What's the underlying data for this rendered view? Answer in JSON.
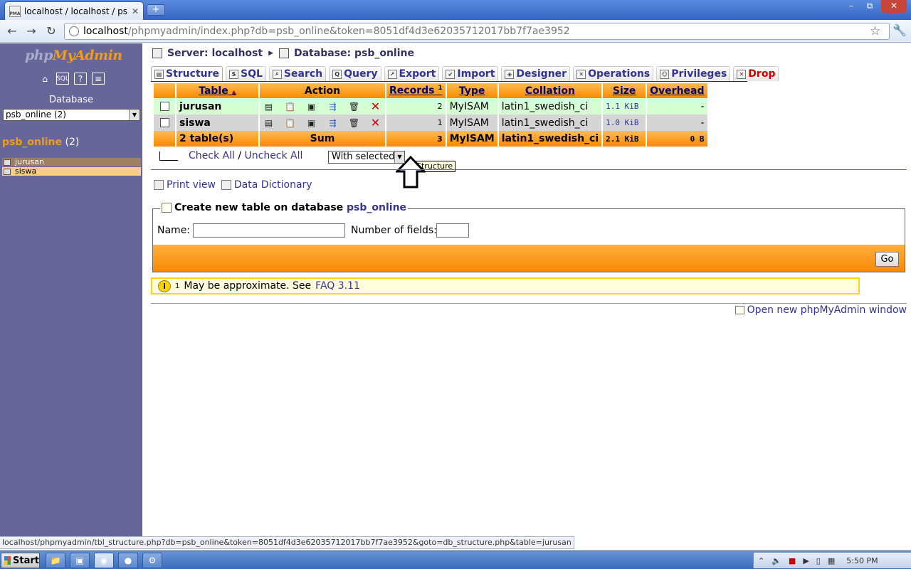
{
  "browser": {
    "tab_title": "localhost / localhost / psb_onli",
    "tab_favicon_text": "PMA",
    "url_host": "localhost",
    "url_rest": "/phpmyadmin/index.php?db=psb_online&token=8051df4d3e62035712017bb7f7ae3952",
    "new_tab_label": "+",
    "minimize_label": "–",
    "maximize_label": "⧉",
    "close_label": "✕"
  },
  "left": {
    "logo_php": "php",
    "logo_myadmin": "MyAdmin",
    "database_label": "Database",
    "database_select": "psb_online (2)",
    "current_db_name": "psb_online",
    "current_db_count": "(2)",
    "tables": [
      "jurusan",
      "siswa"
    ]
  },
  "breadcrumb": {
    "server": "Server: localhost",
    "database": "Database: psb_online"
  },
  "tabs": [
    {
      "label": "Structure",
      "icon": "structure-icon"
    },
    {
      "label": "SQL",
      "icon": "sql-icon"
    },
    {
      "label": "Search",
      "icon": "search-icon"
    },
    {
      "label": "Query",
      "icon": "query-icon"
    },
    {
      "label": "Export",
      "icon": "export-icon"
    },
    {
      "label": "Import",
      "icon": "import-icon"
    },
    {
      "label": "Designer",
      "icon": "designer-icon"
    },
    {
      "label": "Operations",
      "icon": "operations-icon"
    },
    {
      "label": "Privileges",
      "icon": "privileges-icon"
    },
    {
      "label": "Drop",
      "icon": "drop-icon"
    }
  ],
  "table": {
    "headers": {
      "table": "Table",
      "sort_indicator": "▲",
      "action": "Action",
      "records": "Records",
      "records_sup": "1",
      "type": "Type",
      "collation": "Collation",
      "size": "Size",
      "overhead": "Overhead"
    },
    "rows": [
      {
        "name": "jurusan",
        "records": "2",
        "type": "MyISAM",
        "collation": "latin1_swedish_ci",
        "size": "1.1 KiB",
        "overhead": "-"
      },
      {
        "name": "siswa",
        "records": "1",
        "type": "MyISAM",
        "collation": "latin1_swedish_ci",
        "size": "1.0 KiB",
        "overhead": "-"
      }
    ],
    "footer": {
      "count": "2 table(s)",
      "sum_label": "Sum",
      "records": "3",
      "type": "MyISAM",
      "collation": "latin1_swedish_ci",
      "size": "2.1 KiB",
      "overhead": "0 B"
    }
  },
  "tooltip": "Structure",
  "check_all": "Check All",
  "check_sep": "/",
  "uncheck_all": "Uncheck All",
  "with_selected": "With selected:",
  "links": {
    "print_view": "Print view",
    "data_dictionary": "Data Dictionary"
  },
  "create_table": {
    "legend": "Create new table on database",
    "db_name": "psb_online",
    "name_label": "Name:",
    "fields_label": "Number of fields:",
    "go_label": "Go"
  },
  "notice": {
    "sup": "1",
    "text": "May be approximate. See",
    "faq_link": "FAQ 3.11"
  },
  "open_window": "Open new phpMyAdmin window",
  "status_url": "localhost/phpmyadmin/tbl_structure.php?db=psb_online&token=8051df4d3e62035712017bb7f7ae3952&goto=db_structure.php&table=jurusan",
  "taskbar": {
    "start_label": "Start",
    "clock": "5:50 PM"
  }
}
